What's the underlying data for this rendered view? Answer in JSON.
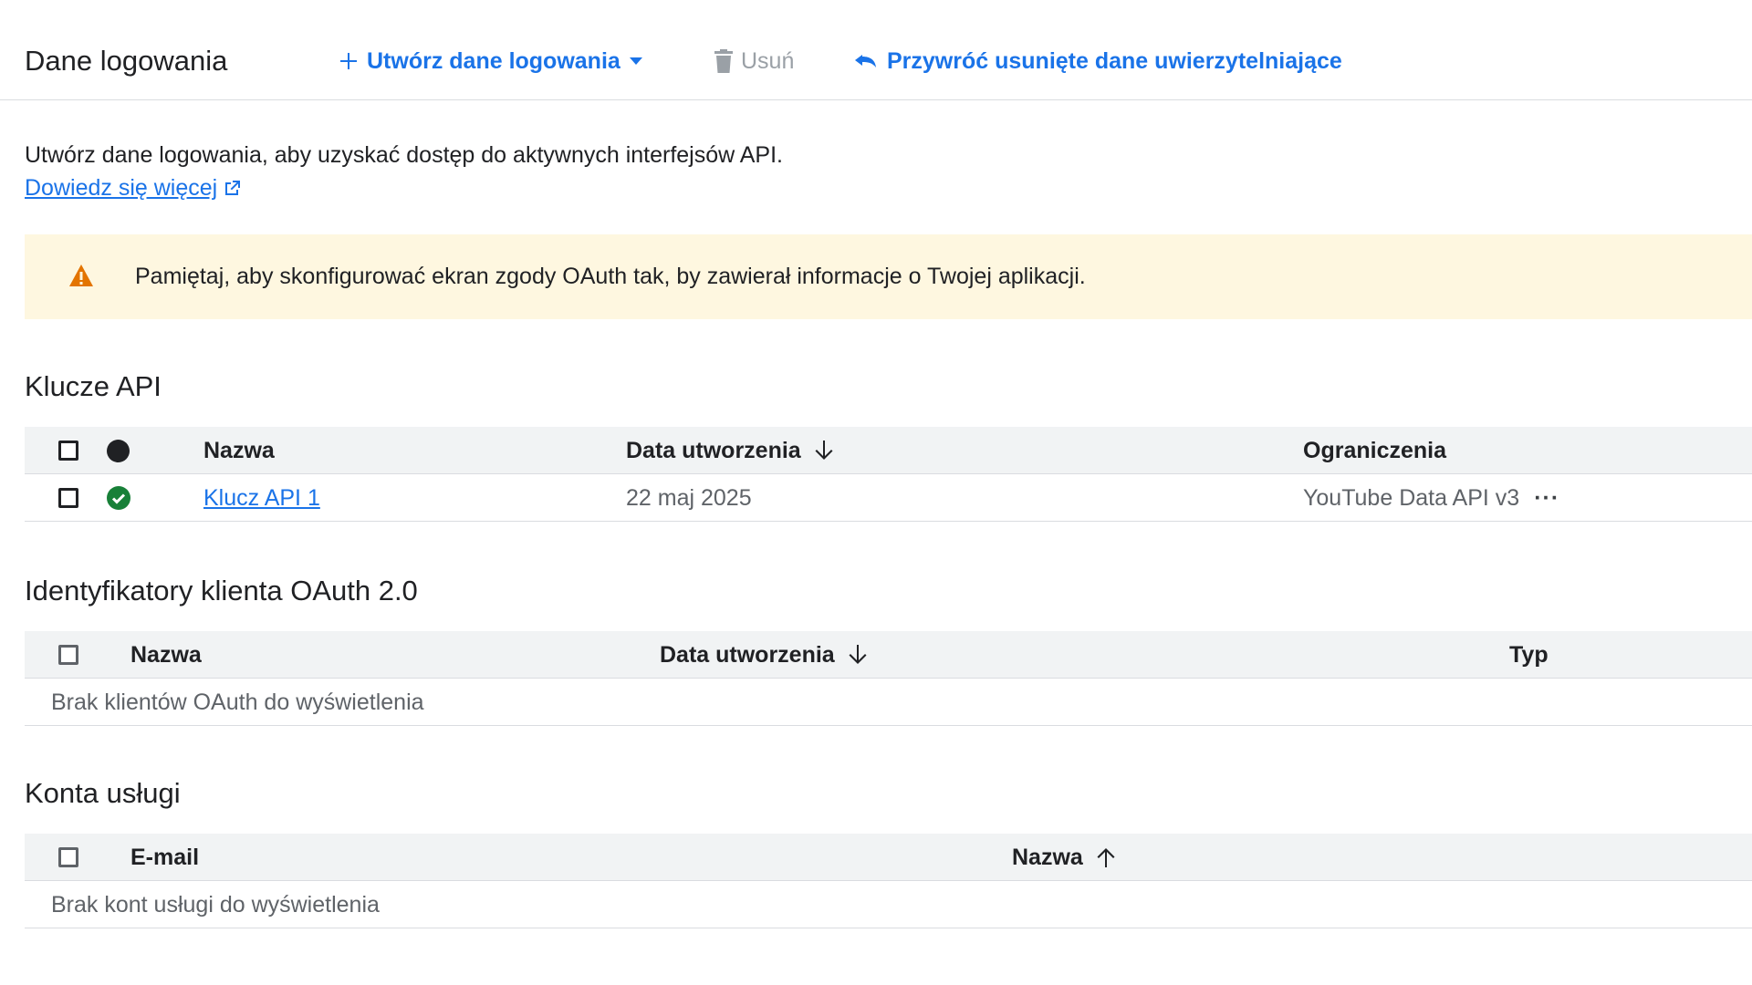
{
  "header": {
    "title": "Dane logowania",
    "create_label": "Utwórz dane logowania",
    "delete_label": "Usuń",
    "restore_label": "Przywróć usunięte dane uwierzytelniające"
  },
  "intro": {
    "text": "Utwórz dane logowania, aby uzyskać dostęp do aktywnych interfejsów API.",
    "learn_more": "Dowiedz się więcej"
  },
  "banner": {
    "message": "Pamiętaj, aby skonfigurować ekran zgody OAuth tak, by zawierał informacje o Twojej aplikacji."
  },
  "api_keys": {
    "title": "Klucze API",
    "columns": {
      "name": "Nazwa",
      "created": "Data utworzenia",
      "restrictions": "Ograniczenia"
    },
    "rows": [
      {
        "name": "Klucz API 1",
        "created": "22 maj 2025",
        "restrictions": "YouTube Data API v3",
        "more": "···"
      }
    ]
  },
  "oauth": {
    "title": "Identyfikatory klienta OAuth 2.0",
    "columns": {
      "name": "Nazwa",
      "created": "Data utworzenia",
      "type": "Typ"
    },
    "empty": "Brak klientów OAuth do wyświetlenia"
  },
  "service_accounts": {
    "title": "Konta usługi",
    "columns": {
      "email": "E-mail",
      "name": "Nazwa"
    },
    "empty": "Brak kont usługi do wyświetlenia"
  },
  "colors": {
    "accent": "#1a73e8",
    "warning": "#e37400",
    "success": "#188038",
    "banner_bg": "#fef7e0"
  }
}
